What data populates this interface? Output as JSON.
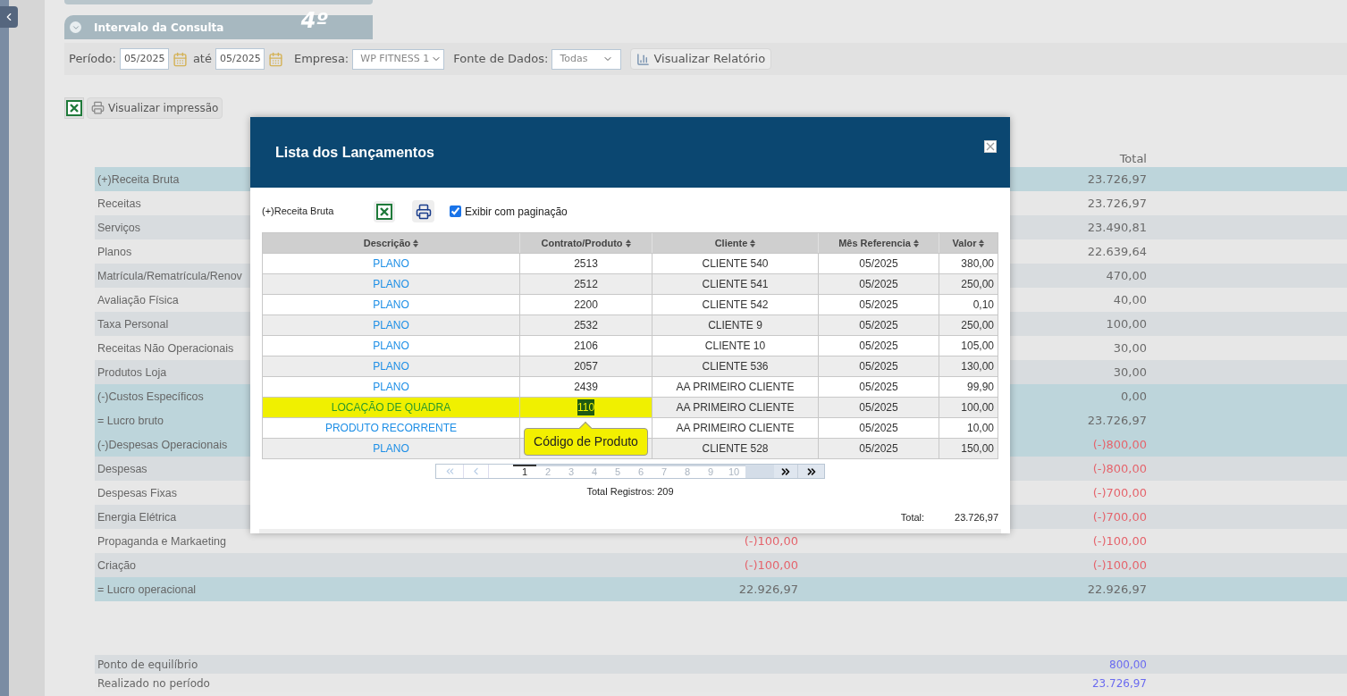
{
  "panel": {
    "title": "Intervalo da Consulta",
    "step": "4º"
  },
  "filters": {
    "period_label": "Período:",
    "from": "05/2025",
    "until_label": "até",
    "to": "05/2025",
    "company_label": "Empresa:",
    "company": "WP FITNESS 1",
    "source_label": "Fonte de Dados:",
    "source": "Todas",
    "report_button": "Visualizar Relatório"
  },
  "print_button": "Visualizar impressão",
  "report": {
    "total_header": "Total",
    "rows": [
      {
        "label": "(+)Receita Bruta",
        "kind": "group",
        "total": "23.726,97",
        "color": "#6b6b6b"
      },
      {
        "label": "Receitas",
        "kind": "row",
        "total": "23.726,97",
        "color": "#6b6b6b"
      },
      {
        "label": "Serviços",
        "kind": "row",
        "total": "23.490,81",
        "color": "#6b6b6b"
      },
      {
        "label": "Planos",
        "kind": "row",
        "total": "22.639,64",
        "color": "#6b6b6b"
      },
      {
        "label": "Matrícula/Rematrícula/Renov",
        "kind": "row",
        "total": "470,00",
        "color": "#6b6b6b"
      },
      {
        "label": "Avaliação Física",
        "kind": "row",
        "total": "40,00",
        "color": "#6b6b6b"
      },
      {
        "label": "Taxa Personal",
        "kind": "row",
        "total": "100,00",
        "color": "#6b6b6b"
      },
      {
        "label": "Receitas Não Operacionais",
        "kind": "row",
        "total": "30,00",
        "color": "#6b6b6b"
      },
      {
        "label": "Produtos Loja",
        "kind": "row",
        "total": "30,00",
        "color": "#6b6b6b"
      },
      {
        "label": "(-)Custos Específicos",
        "kind": "group",
        "total": "0,00",
        "color": "#6b6b6b"
      },
      {
        "label": "= Lucro bruto",
        "kind": "group",
        "total": "23.726,97",
        "color": "#6b6b6b"
      },
      {
        "label": "(-)Despesas Operacionais",
        "kind": "group",
        "total": "(-)800,00",
        "color": "#e5646c"
      },
      {
        "label": "Despesas",
        "kind": "row",
        "total": "(-)800,00",
        "color": "#e5646c"
      },
      {
        "label": "Despesas Fixas",
        "kind": "row",
        "total": "(-)700,00",
        "color": "#e5646c"
      },
      {
        "label": "Energia Elétrica",
        "kind": "row",
        "total": "(-)700,00",
        "color": "#e5646c"
      },
      {
        "label": "Propaganda e Markaeting",
        "kind": "row",
        "period": "(-)100,00",
        "total": "(-)100,00",
        "color": "#e5646c"
      },
      {
        "label": "Criação",
        "kind": "row",
        "period": "(-)100,00",
        "total": "(-)100,00",
        "color": "#e5646c"
      },
      {
        "label": "= Lucro operacional",
        "kind": "group",
        "period": "22.926,97",
        "total": "22.926,97",
        "color": "#6b6b6b"
      }
    ]
  },
  "summary": [
    {
      "label": "Ponto de equilíbrio",
      "total": "800,00",
      "color": "#6b6bf0"
    },
    {
      "label": "Realizado no período",
      "total": "23.726,97",
      "color": "#6b6bf0"
    }
  ],
  "modal": {
    "title": "Lista dos Lançamentos",
    "group": "(+)Receita Bruta",
    "paginate": {
      "label": "Exibir com paginação",
      "checked": true
    },
    "columns": [
      "Descrição",
      "Contrato/Produto",
      "Cliente",
      "Mês Referencia",
      "Valor"
    ],
    "rows": [
      {
        "description": "PLANO",
        "contract": "2513",
        "client": "CLIENTE 540",
        "month": "05/2025",
        "value": "380,00",
        "highlighted": false
      },
      {
        "description": "PLANO",
        "contract": "2512",
        "client": "CLIENTE 541",
        "month": "05/2025",
        "value": "250,00",
        "highlighted": false
      },
      {
        "description": "PLANO",
        "contract": "2200",
        "client": "CLIENTE 542",
        "month": "05/2025",
        "value": "0,10",
        "highlighted": false
      },
      {
        "description": "PLANO",
        "contract": "2532",
        "client": "CLIENTE 9",
        "month": "05/2025",
        "value": "250,00",
        "highlighted": false
      },
      {
        "description": "PLANO",
        "contract": "2106",
        "client": "CLIENTE 10",
        "month": "05/2025",
        "value": "105,00",
        "highlighted": false
      },
      {
        "description": "PLANO",
        "contract": "2057",
        "client": "CLIENTE 536",
        "month": "05/2025",
        "value": "130,00",
        "highlighted": false
      },
      {
        "description": "PLANO",
        "contract": "2439",
        "client": "AA PRIMEIRO CLIENTE",
        "month": "05/2025",
        "value": "99,90",
        "highlighted": false
      },
      {
        "description": "LOCAÇÃO DE QUADRA",
        "contract": "110",
        "client": "AA PRIMEIRO CLIENTE",
        "month": "05/2025",
        "value": "100,00",
        "highlighted": true
      },
      {
        "description": "PRODUTO RECORRENTE",
        "client": "AA PRIMEIRO CLIENTE",
        "month": "05/2025",
        "value": "10,00",
        "highlighted": false
      },
      {
        "description": "PLANO",
        "client": "CLIENTE 528",
        "month": "05/2025",
        "value": "150,00",
        "highlighted": false
      }
    ],
    "tooltip": "Código de Produto",
    "pages": [
      {
        "label": "1",
        "selected": true
      },
      {
        "label": "2",
        "selected": false
      },
      {
        "label": "3",
        "selected": false
      },
      {
        "label": "4",
        "selected": false
      },
      {
        "label": "5",
        "selected": false
      },
      {
        "label": "6",
        "selected": false
      },
      {
        "label": "7",
        "selected": false
      },
      {
        "label": "8",
        "selected": false
      },
      {
        "label": "9",
        "selected": false
      },
      {
        "label": "10",
        "selected": false
      }
    ],
    "records": "Total Registros: 209",
    "total_label": "Total:",
    "total": "23.726,97"
  }
}
